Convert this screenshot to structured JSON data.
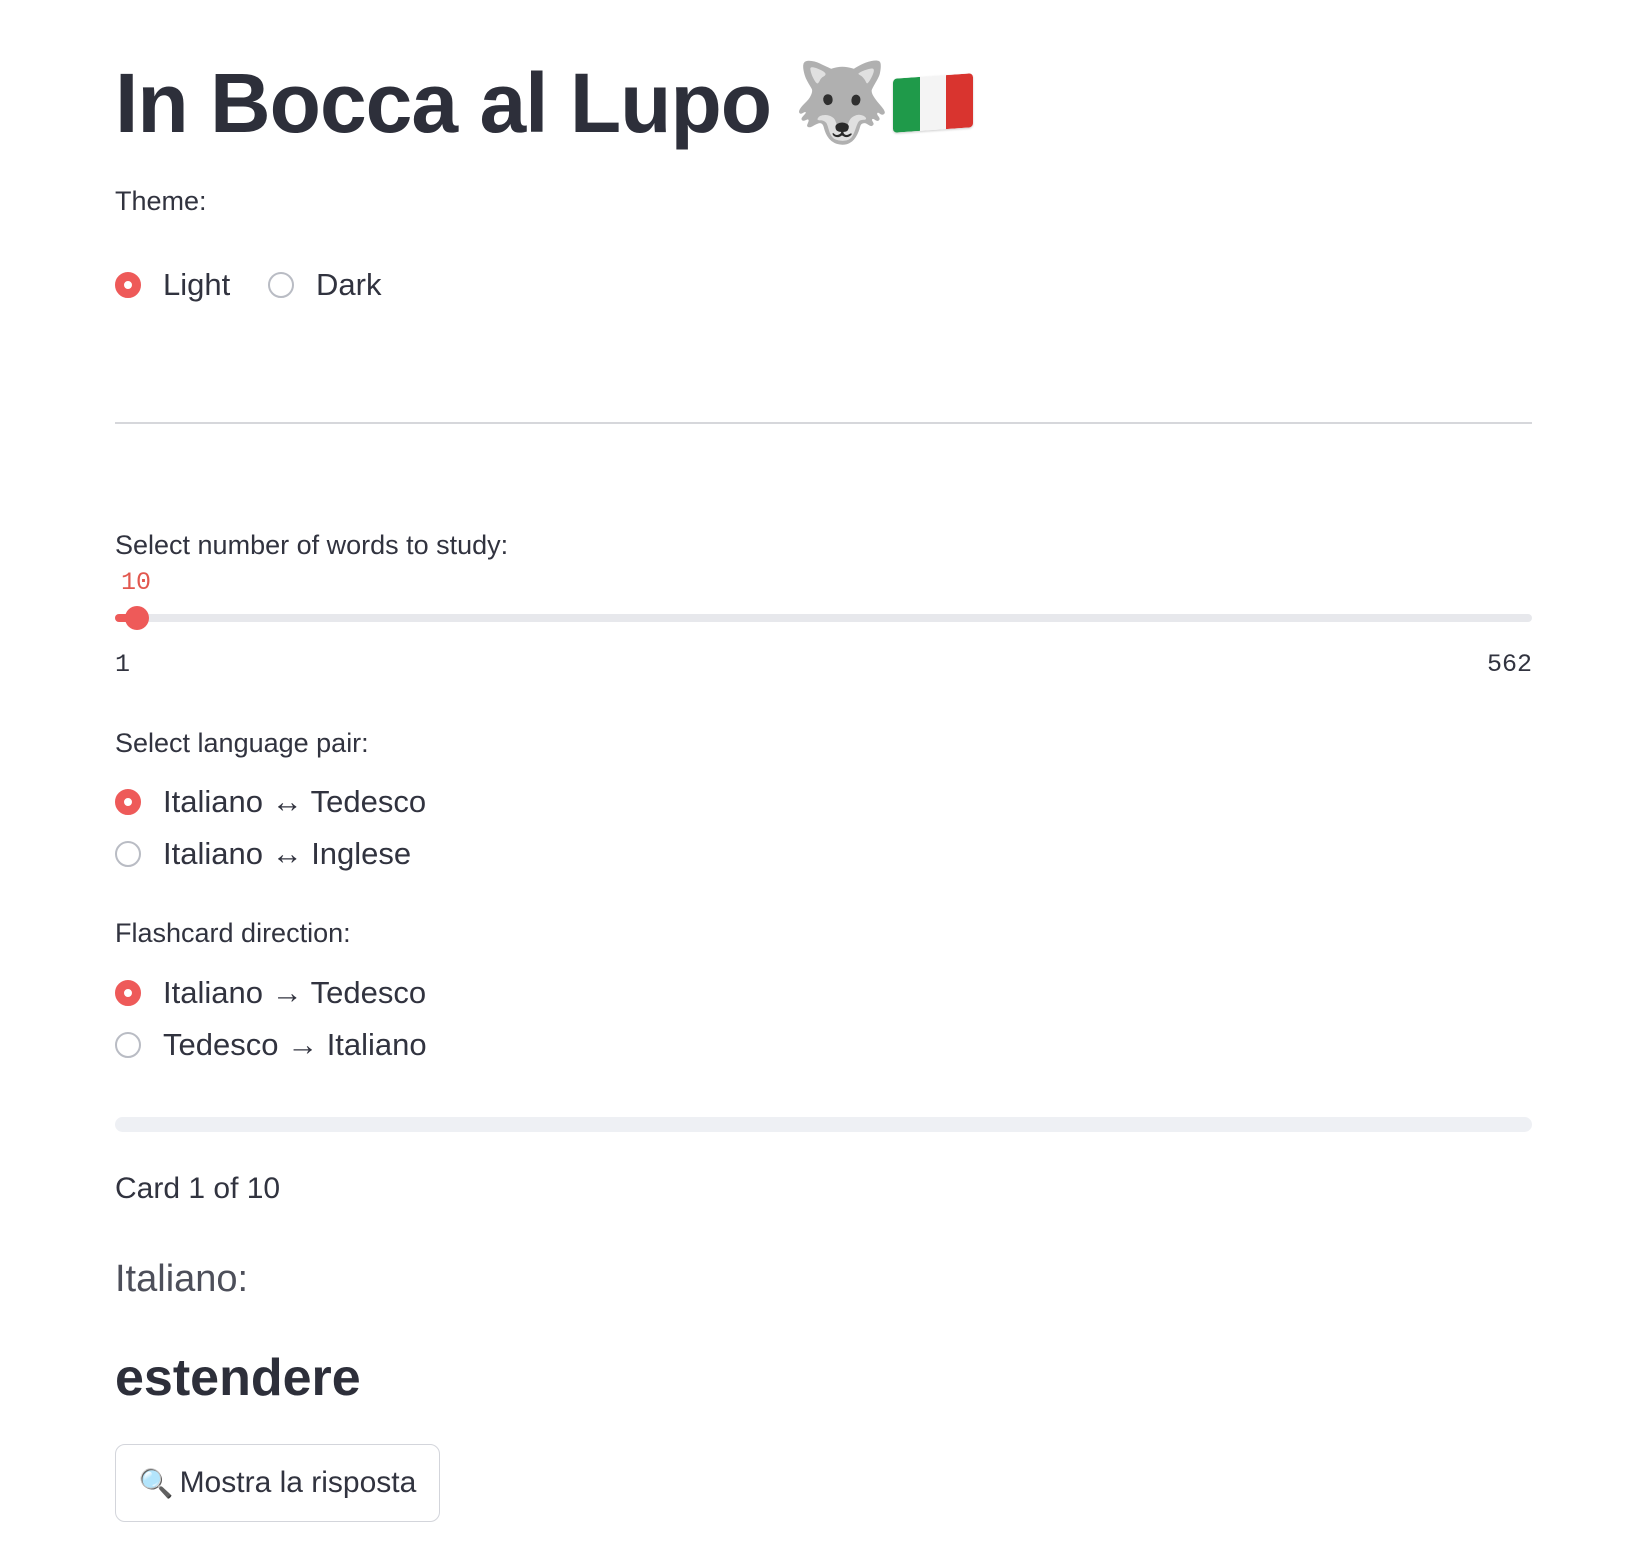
{
  "header": {
    "title": "In Bocca al Lupo",
    "wolf_icon": "🐺",
    "flag_icon": "italian-flag",
    "flag_colors": [
      "#1f9a4a",
      "#f4f4f4",
      "#d9342f"
    ]
  },
  "theme": {
    "label": "Theme:",
    "options": [
      {
        "label": "Light",
        "selected": true
      },
      {
        "label": "Dark",
        "selected": false
      }
    ]
  },
  "slider": {
    "label": "Select number of words to study:",
    "value": "10",
    "min": "1",
    "max": "562"
  },
  "language_pair": {
    "label": "Select language pair:",
    "options": [
      {
        "label": "Italiano ↔ Tedesco",
        "selected": true
      },
      {
        "label": "Italiano ↔ Inglese",
        "selected": false
      }
    ]
  },
  "direction": {
    "label": "Flashcard direction:",
    "options": [
      {
        "label": "Italiano → Tedesco",
        "selected": true
      },
      {
        "label": "Tedesco → Italiano",
        "selected": false
      }
    ]
  },
  "progress": {
    "value": 0
  },
  "card": {
    "counter": "Card 1 of 10",
    "side_label": "Italiano:",
    "word": "estendere",
    "reveal_button_icon": "🔍",
    "reveal_button_label": "Mostra la risposta"
  },
  "colors": {
    "accent": "#ee5a59",
    "text": "#31333f"
  }
}
